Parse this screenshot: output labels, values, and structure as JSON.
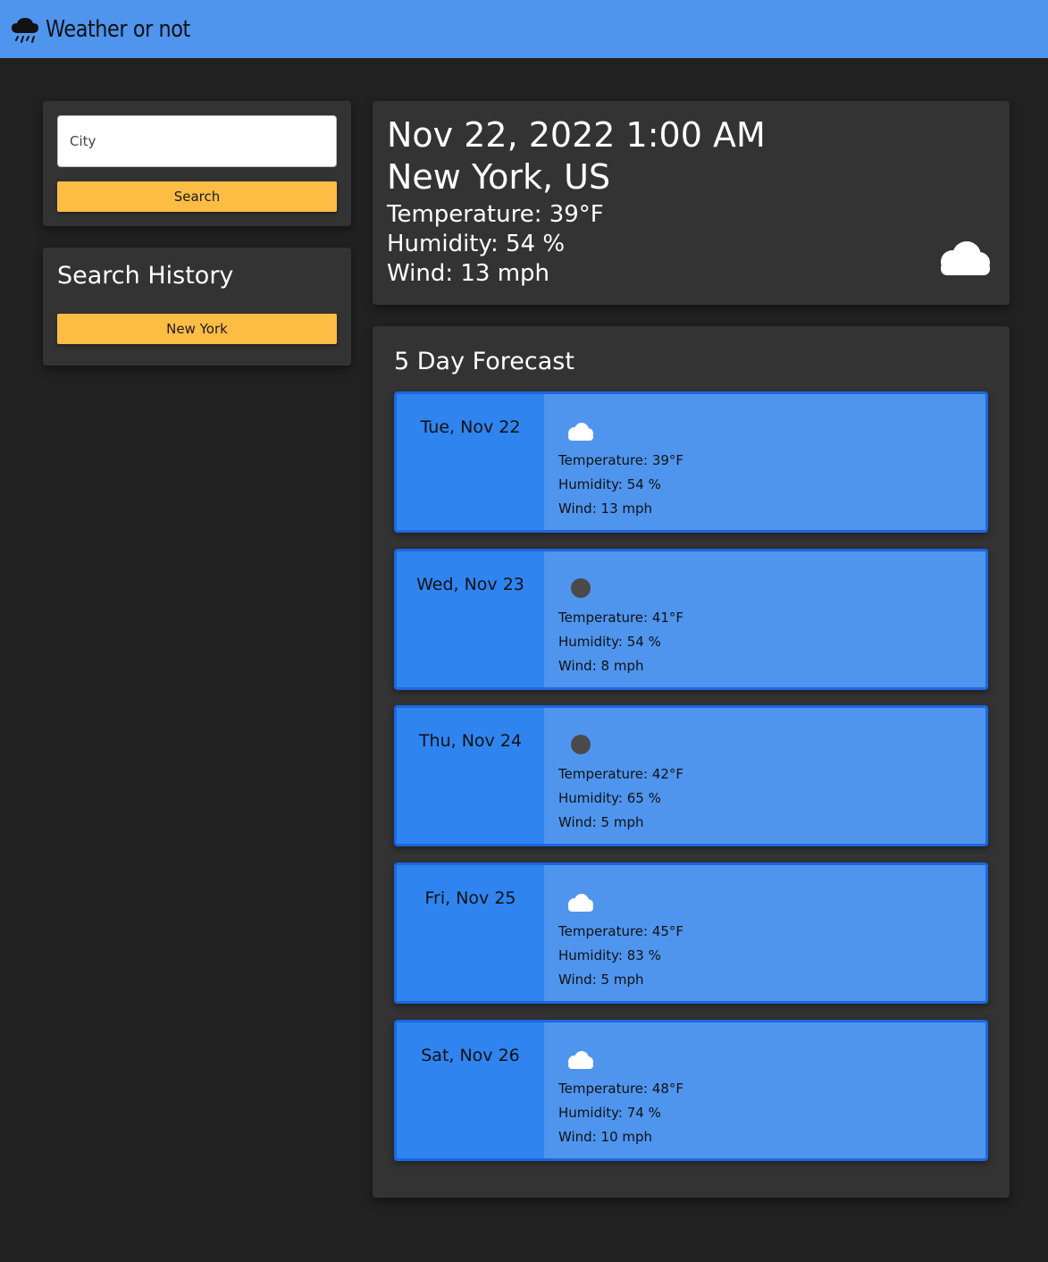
{
  "app": {
    "title": "Weather or not",
    "icon": "cloud-rain-icon"
  },
  "search": {
    "placeholder": "City",
    "value": "",
    "button_label": "Search"
  },
  "history": {
    "title": "Search History",
    "items": [
      "New York"
    ]
  },
  "current": {
    "datetime": "Nov 22, 2022 1:00 AM",
    "city": "New York, US",
    "temperature": "Temperature: 39°F",
    "humidity": "Humidity: 54 %",
    "wind": "Wind: 13 mph",
    "icon": "cloud-icon"
  },
  "forecast": {
    "title": "5 Day Forecast",
    "days": [
      {
        "date": "Tue, Nov 22",
        "icon": "cloud-icon",
        "temperature": "Temperature: 39°F",
        "humidity": "Humidity: 54 %",
        "wind": "Wind: 13 mph"
      },
      {
        "date": "Wed, Nov 23",
        "icon": "moon-icon",
        "temperature": "Temperature: 41°F",
        "humidity": "Humidity: 54 %",
        "wind": "Wind: 8 mph"
      },
      {
        "date": "Thu, Nov 24",
        "icon": "moon-icon",
        "temperature": "Temperature: 42°F",
        "humidity": "Humidity: 65 %",
        "wind": "Wind: 5 mph"
      },
      {
        "date": "Fri, Nov 25",
        "icon": "cloud-icon",
        "temperature": "Temperature: 45°F",
        "humidity": "Humidity: 83 %",
        "wind": "Wind: 5 mph"
      },
      {
        "date": "Sat, Nov 26",
        "icon": "cloud-icon",
        "temperature": "Temperature: 48°F",
        "humidity": "Humidity: 74 %",
        "wind": "Wind: 10 mph"
      }
    ]
  },
  "colors": {
    "header": "#4f95ee",
    "background": "#212121",
    "panel": "#333333",
    "accent_yellow": "#fdbd45",
    "card": "#4f95ee",
    "card_date": "#2f84f0",
    "card_border": "#1c67e0",
    "moon": "#4a4a4a"
  }
}
